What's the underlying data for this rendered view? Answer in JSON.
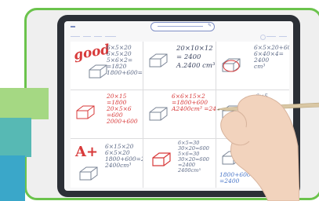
{
  "toolbar": {
    "menu_icon": "menu-icon",
    "pen_icon": "pen-icon",
    "search_hint": ""
  },
  "worksheet": {
    "cells": [
      {
        "title": "good",
        "lines": "6×5×20\n6×5×20\n5×6×2=\n=1820\n1800+600=2400"
      },
      {
        "title": "",
        "lines": "20×10×12\n= 2400\nA.2400 cm³"
      },
      {
        "title": "",
        "lines": "6×5×20+600\n6×40×4=\n2400\ncm³"
      },
      {
        "title": "",
        "lines": "20×15\n=1800\n20×5×6\n=600\n2000+600"
      },
      {
        "title": "",
        "lines": "6×6×15×2\n=1800+600\nA2400cm³ =2400"
      },
      {
        "title": "",
        "lines": "6×5\n= 90\n24\n+600"
      },
      {
        "title": "A+",
        "lines": "6×15×20\n6×5×20\n1800+600=2400\n2400cm³"
      },
      {
        "title": "",
        "lines": "6×5=30\n30×20=600\n5×6=30\n30×20=600\n=2400\n2400cm³"
      },
      {
        "title": "",
        "lines": "1800+600\n=2400"
      }
    ]
  },
  "colors": {
    "frame": "#6bc34c",
    "bezel": "#2b2f36",
    "ink": "#5d6a86",
    "red_ink": "#d83a3a",
    "toolbar": "#7e8fc6"
  }
}
